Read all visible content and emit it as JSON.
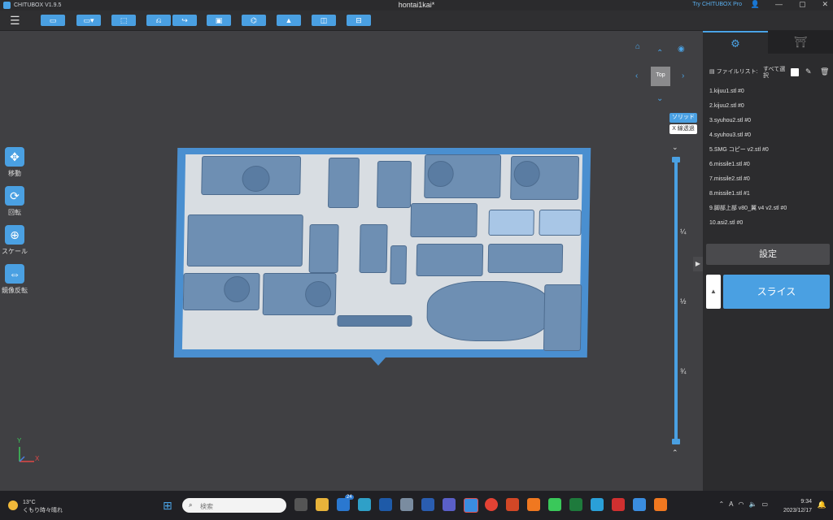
{
  "titlebar": {
    "app_name": "CHITUBOX V1.9.5",
    "document": "hontai1kai*",
    "promo": "Try CHITUBOX Pro",
    "user_icon": "user-icon",
    "window_controls": [
      "—",
      "▢",
      "✕"
    ]
  },
  "toolbar": {
    "menu_icon": "☰",
    "buttons": [
      {
        "icon": "folder-open-icon",
        "glyph": "▭"
      },
      {
        "icon": "save-icon",
        "glyph": "▭▾"
      },
      {
        "icon": "select-icon",
        "glyph": "⬚"
      },
      {
        "icon": "undo-icon",
        "glyph": "⎌"
      },
      {
        "icon": "redo-icon",
        "glyph": "↪"
      },
      {
        "icon": "layout-icon",
        "glyph": "▣"
      },
      {
        "icon": "hollow-icon",
        "glyph": "⌬"
      },
      {
        "icon": "support-icon",
        "glyph": "▲"
      },
      {
        "icon": "frame-icon",
        "glyph": "◫"
      },
      {
        "icon": "box-icon",
        "glyph": "⊟"
      }
    ]
  },
  "left_tools": [
    {
      "label": "移動",
      "glyph": "✥"
    },
    {
      "label": "回転",
      "glyph": "⟳"
    },
    {
      "label": "スケール",
      "glyph": "⊕"
    },
    {
      "label": "鏡像反転",
      "glyph": "⇔"
    }
  ],
  "view": {
    "cube_label": "Top",
    "solid_label": "ソリッド",
    "xray_label": "X 線透過"
  },
  "slider": {
    "ticks": [
      "¼",
      "½",
      "¾"
    ]
  },
  "axes": {
    "y": "Y",
    "x": "X"
  },
  "panel": {
    "tab1_glyph": "⚙",
    "tab2_glyph": "⛩",
    "file_list_label": "ファイルリスト:",
    "select_all_label": "すべて選択",
    "files": [
      "1.kijuu1.stl #0",
      "2.kijuu2.stl #0",
      "3.syuhou2.stl #0",
      "4.syuhou3.stl #0",
      "5.SMG コピー v2.stl #0",
      "6.missile1.stl #0",
      "7.missile2.stl #0",
      "8.missile1.stl #1",
      "9.脚部上部 v80_翼 v4 v2.stl #0",
      "10.asi2.stl #0"
    ],
    "settings_label": "設定",
    "slice_label": "スライス",
    "slice_option_glyph": "▲"
  },
  "taskbar": {
    "weather_temp": "13°C",
    "weather_desc": "くもり時々晴れ",
    "search_placeholder": "検索",
    "badge": "24",
    "tray_lang": "A",
    "time": "9:34",
    "date": "2023/12/17"
  },
  "colors": {
    "accent": "#4aa0e2",
    "plate": "#4a8fd0",
    "model": "#6e8fb3",
    "panel": "#2c2c2e"
  }
}
